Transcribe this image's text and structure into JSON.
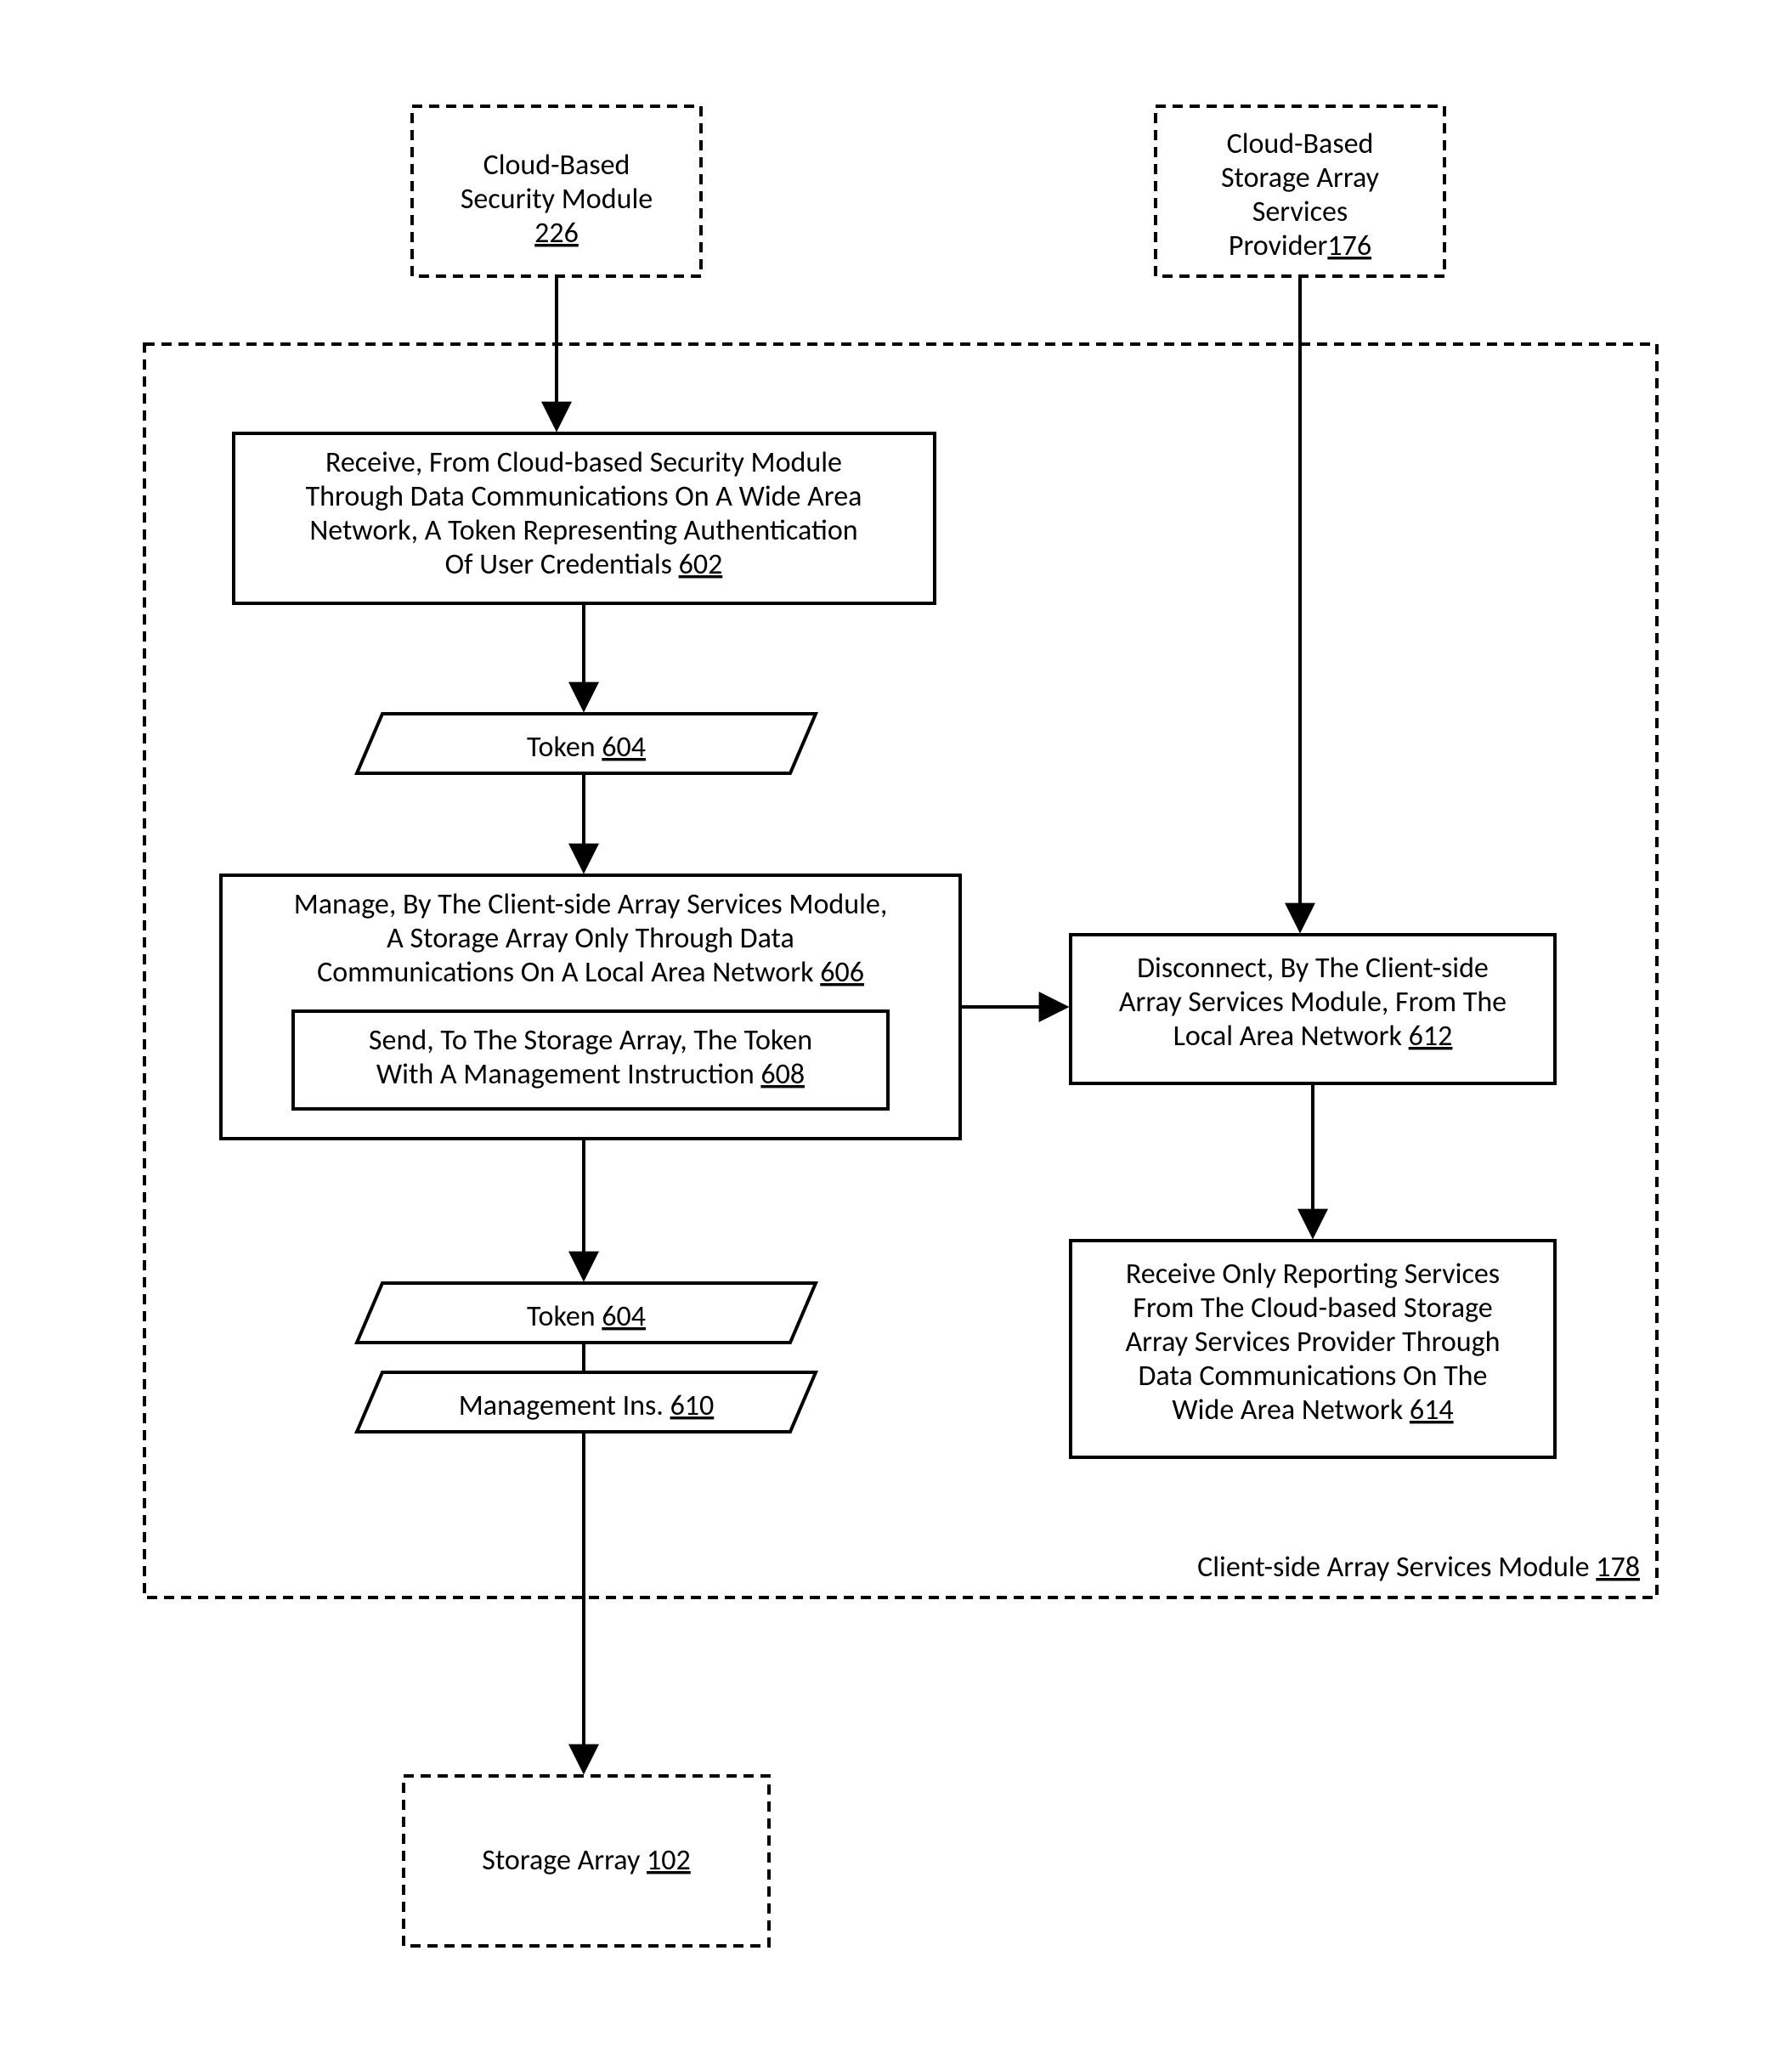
{
  "chart_data": {
    "type": "flowchart",
    "nodes": [
      {
        "id": "sec",
        "ref": "226",
        "style": "dashed-rect",
        "label": "Cloud-Based Security Module"
      },
      {
        "id": "prov",
        "ref": "176",
        "style": "dashed-rect",
        "label": "Cloud-Based Storage Array Services Provider"
      },
      {
        "id": "client",
        "ref": "178",
        "style": "dashed-rect",
        "label": "Client-side Array Services Module"
      },
      {
        "id": "recv",
        "ref": "602",
        "style": "rect",
        "label": "Receive, From Cloud-based Security Module Through Data Communications On A Wide Area Network, A Token Representing Authentication Of User Credentials"
      },
      {
        "id": "tok1",
        "ref": "604",
        "style": "parallelogram",
        "label": "Token"
      },
      {
        "id": "manage",
        "ref": "606",
        "style": "rect",
        "label": "Manage, By The Client-side Array Services Module, A Storage Array Only Through Data Communications On A Local Area Network"
      },
      {
        "id": "send",
        "ref": "608",
        "style": "rect-inner",
        "label": "Send, To The Storage Array, The Token With A Management Instruction"
      },
      {
        "id": "tok2",
        "ref": "604",
        "style": "parallelogram",
        "label": "Token"
      },
      {
        "id": "mins",
        "ref": "610",
        "style": "parallelogram",
        "label": "Management Ins."
      },
      {
        "id": "disc",
        "ref": "612",
        "style": "rect",
        "label": "Disconnect, By The Client-side Array Services Module, From The Local Area Network"
      },
      {
        "id": "rep",
        "ref": "614",
        "style": "rect",
        "label": "Receive Only Reporting Services From The Cloud-based Storage Array Services Provider Through Data Communications On The Wide Area Network"
      },
      {
        "id": "store",
        "ref": "102",
        "style": "dashed-rect",
        "label": "Storage Array"
      }
    ],
    "edges": [
      {
        "from": "sec",
        "to": "recv"
      },
      {
        "from": "recv",
        "to": "tok1"
      },
      {
        "from": "tok1",
        "to": "manage"
      },
      {
        "from": "manage",
        "to": "tok2"
      },
      {
        "from": "tok2",
        "to": "mins"
      },
      {
        "from": "mins",
        "to": "store"
      },
      {
        "from": "manage",
        "to": "disc"
      },
      {
        "from": "prov",
        "to": "disc"
      },
      {
        "from": "disc",
        "to": "rep"
      }
    ]
  },
  "sec": {
    "l1": "Cloud-Based",
    "l2": "Security Module",
    "ref": "226"
  },
  "prov": {
    "l1": "Cloud-Based",
    "l2": "Storage Array",
    "l3": "Services",
    "l4pre": "Provider",
    "ref": "176"
  },
  "recv": {
    "l1": "Receive, From Cloud-based Security Module",
    "l2": "Through Data Communications On A Wide Area",
    "l3": "Network, A Token Representing Authentication",
    "l4pre": "Of User Credentials ",
    "ref": "602"
  },
  "tok1": {
    "l1pre": "Token ",
    "ref": "604"
  },
  "manage": {
    "l1": "Manage, By The Client-side Array Services Module,",
    "l2": "A Storage Array Only Through Data",
    "l3pre": "Communications On A Local Area Network ",
    "ref": "606"
  },
  "send": {
    "l1": "Send, To The Storage Array, The Token",
    "l2pre": "With A Management Instruction ",
    "ref": "608"
  },
  "tok2": {
    "l1pre": "Token ",
    "ref": "604"
  },
  "mins": {
    "l1pre": "Management Ins. ",
    "ref": "610"
  },
  "disc": {
    "l1": "Disconnect, By The Client-side",
    "l2": "Array Services Module, From The",
    "l3pre": "Local Area Network  ",
    "ref": "612"
  },
  "rep": {
    "l1": "Receive Only Reporting Services",
    "l2": "From The Cloud-based Storage",
    "l3": "Array Services Provider Through",
    "l4": "Data Communications On The",
    "l5pre": "Wide Area Network ",
    "ref": "614"
  },
  "client": {
    "l1pre": "Client-side Array Services Module ",
    "ref": "178"
  },
  "store": {
    "l1pre": "Storage Array ",
    "ref": "102"
  }
}
